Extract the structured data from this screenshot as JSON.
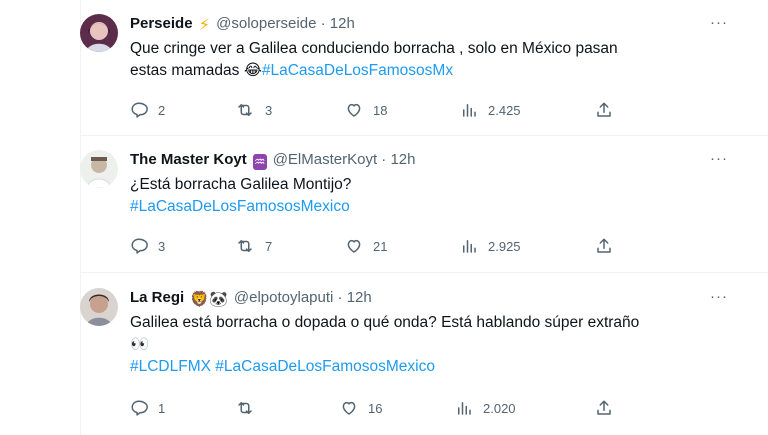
{
  "tweets": [
    {
      "name": "Perseide",
      "handle": "@soloperseide",
      "sep": "·",
      "time": "12h",
      "text_lines": [
        "Que cringe ver a Galilea conduciendo borracha , solo en México pasan",
        "estas mamadas 😂"
      ],
      "hashtags": "#LaCasaDeLosFamososMx",
      "replies": "2",
      "retweets": "3",
      "likes": "18",
      "views": "2.425",
      "more": "···"
    },
    {
      "name": "The Master Koyt",
      "handle": "@ElMasterKoyt",
      "sep": "·",
      "time": "12h",
      "text_lines": [
        "¿Está borracha Galilea Montijo?"
      ],
      "hashtags": "#LaCasaDeLosFamososMexico",
      "replies": "3",
      "retweets": "7",
      "likes": "21",
      "views": "2.925",
      "more": "···"
    },
    {
      "name": "La Regi",
      "handle": "@elpotoylaputi",
      "sep": "·",
      "time": "12h",
      "text_lines": [
        "Galilea está borracha o dopada o qué onda? Está hablando súper extraño",
        "👀"
      ],
      "hashtags": "#LCDLFMX #LaCasaDeLosFamososMexico",
      "replies": "1",
      "retweets": "",
      "likes": "16",
      "views": "2.020",
      "more": "···"
    }
  ],
  "badges": {
    "perseide": "⚡",
    "koyt": "♒",
    "regi": "🦁🐼"
  },
  "colors": {
    "text": "#0f1419",
    "secondary": "#536471",
    "link": "#1d9bf0",
    "border": "#eff3f4",
    "lightning": "#f4b400",
    "aquarius": "#8e44ad"
  }
}
